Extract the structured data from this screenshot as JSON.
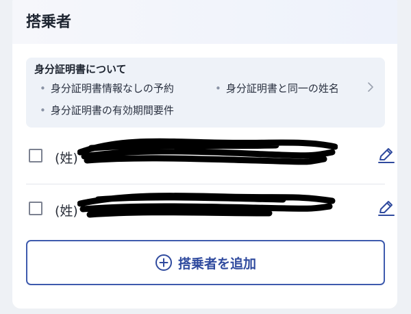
{
  "section": {
    "title": "搭乗者"
  },
  "info": {
    "heading": "身分証明書について",
    "links": [
      "身分証明書情報なしの予約",
      "身分証明書と同一の姓名",
      "身分証明書の有効期間要件"
    ],
    "bullet": "•"
  },
  "passengers": [
    {
      "prefix": "(姓)",
      "checked": false
    },
    {
      "prefix": "(姓)",
      "checked": false
    }
  ],
  "add_button": {
    "label": "搭乗者を追加"
  },
  "colors": {
    "accent": "#2f4a9e",
    "info_bg": "#eef2f8",
    "redaction": "#000000"
  },
  "icons": [
    "chevron-right-icon",
    "edit-pencil-icon",
    "plus-circle-icon"
  ]
}
